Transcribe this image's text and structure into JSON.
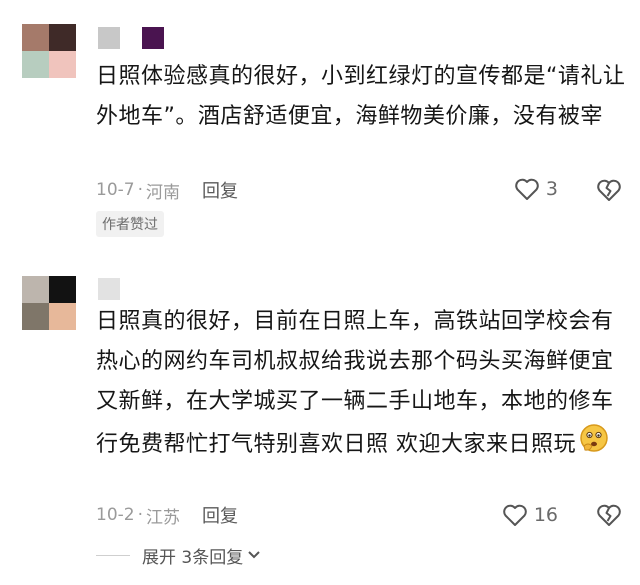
{
  "comments": [
    {
      "text": "日照体验感真的很好，小到红绿灯的宣传都是“请礼让外地车”。酒店舒适便宜，海鲜物美价廉，没有被宰",
      "date": "10-7",
      "location": "河南",
      "reply_label": "回复",
      "likes": "3",
      "tag": "作者赞过",
      "avatar_colors": [
        "#a57a6a",
        "#3f2a28",
        "#b7cdbf",
        "#f0c4bd"
      ],
      "nick_colors": [
        "#c8c8c8",
        "#4a1450"
      ]
    },
    {
      "text": "日照真的很好，目前在日照上车，高铁站回学校会有热心的网约车司机叔叔给我说去那个码头买海鲜便宜又新鲜，在大学城买了一辆二手山地车，本地的修车行免费帮忙打气特别喜欢日照 欢迎大家来日照玩",
      "date": "10-2",
      "location": "江苏",
      "reply_label": "回复",
      "likes": "16",
      "avatar_colors": [
        "#bdb5ad",
        "#121212",
        "#7f7669",
        "#e7b89a"
      ],
      "nick_colors": [
        "#e2e2e2"
      ]
    }
  ],
  "expand_label": "展开 3条回复",
  "separator": "·",
  "icons": {
    "like": "heart-outline-icon",
    "dislike": "broken-heart-icon",
    "expand": "chevron-down-icon",
    "emoji": "thinking-face-emoji"
  }
}
